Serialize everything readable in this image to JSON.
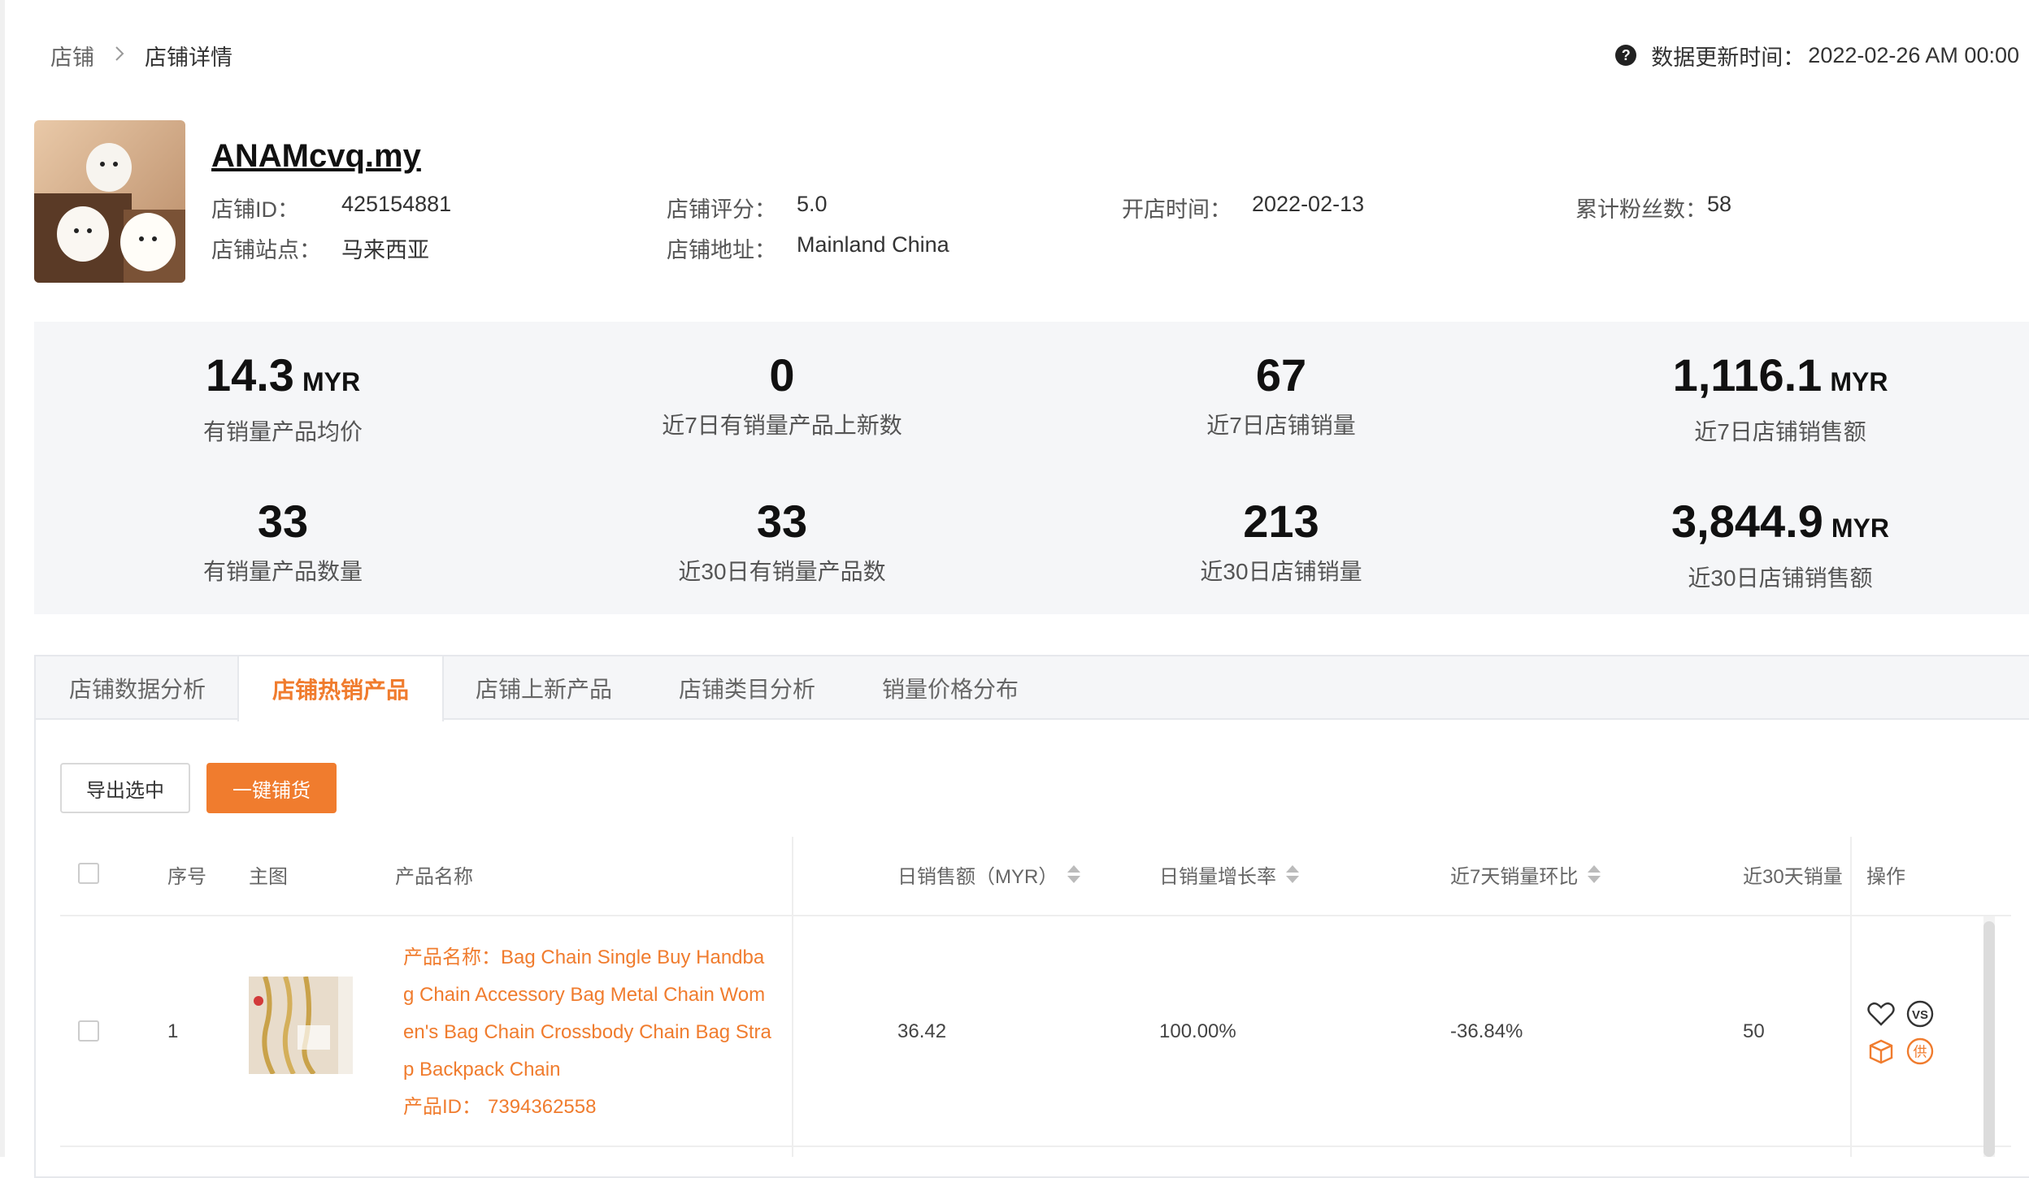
{
  "breadcrumb": {
    "root": "店铺",
    "separator": ">",
    "current": "店铺详情"
  },
  "update": {
    "label": "数据更新时间：",
    "value": "2022-02-26 AM 00:00"
  },
  "store": {
    "name": "ANAMcvq.my",
    "id_label": "店铺ID：",
    "id": "425154881",
    "rating_label": "店铺评分：",
    "rating": "5.0",
    "open_label": "开店时间：",
    "open_date": "2022-02-13",
    "fans_label": "累计粉丝数：",
    "fans": "58",
    "site_label": "店铺站点：",
    "site": "马来西亚",
    "address_label": "店铺地址：",
    "address": "Mainland China"
  },
  "stats": [
    {
      "value": "14.3",
      "unit": "MYR",
      "label": "有销量产品均价"
    },
    {
      "value": "0",
      "unit": "",
      "label": "近7日有销量产品上新数"
    },
    {
      "value": "67",
      "unit": "",
      "label": "近7日店铺销量"
    },
    {
      "value": "1,116.1",
      "unit": "MYR",
      "label": "近7日店铺销售额"
    },
    {
      "value": "33",
      "unit": "",
      "label": "有销量产品数量"
    },
    {
      "value": "33",
      "unit": "",
      "label": "近30日有销量产品数"
    },
    {
      "value": "213",
      "unit": "",
      "label": "近30日店铺销量"
    },
    {
      "value": "3,844.9",
      "unit": "MYR",
      "label": "近30日店铺销售额"
    }
  ],
  "tabs": [
    "店铺数据分析",
    "店铺热销产品",
    "店铺上新产品",
    "店铺类目分析",
    "销量价格分布"
  ],
  "active_tab": "店铺热销产品",
  "buttons": {
    "export": "导出选中",
    "one_click": "一键铺货"
  },
  "table": {
    "headers": {
      "index": "序号",
      "image": "主图",
      "name": "产品名称",
      "daily_sales": "日销售额（MYR）",
      "growth": "日销量增长率",
      "ratio7": "近7天销量环比",
      "sales30": "近30天销量",
      "ops": "操作"
    },
    "rows": [
      {
        "index": "1",
        "name_label": "产品名称：",
        "name": "Bag Chain Single Buy Handbag Chain Accessory Bag Metal Chain Women's Bag Chain Crossbody Chain Bag Strap Backpack Chain",
        "id_label": "产品ID：",
        "id": "7394362558",
        "daily_sales": "36.42",
        "growth": "100.00%",
        "ratio7": "-36.84%",
        "sales30": "50"
      }
    ]
  },
  "icons": {
    "help": "question-circle-icon",
    "favorite": "heart-icon",
    "compare": "vs-icon",
    "package": "package-icon",
    "supply": "supply-icon"
  },
  "colors": {
    "accent": "#f07c2e",
    "panel_bg": "#f5f6f8"
  }
}
